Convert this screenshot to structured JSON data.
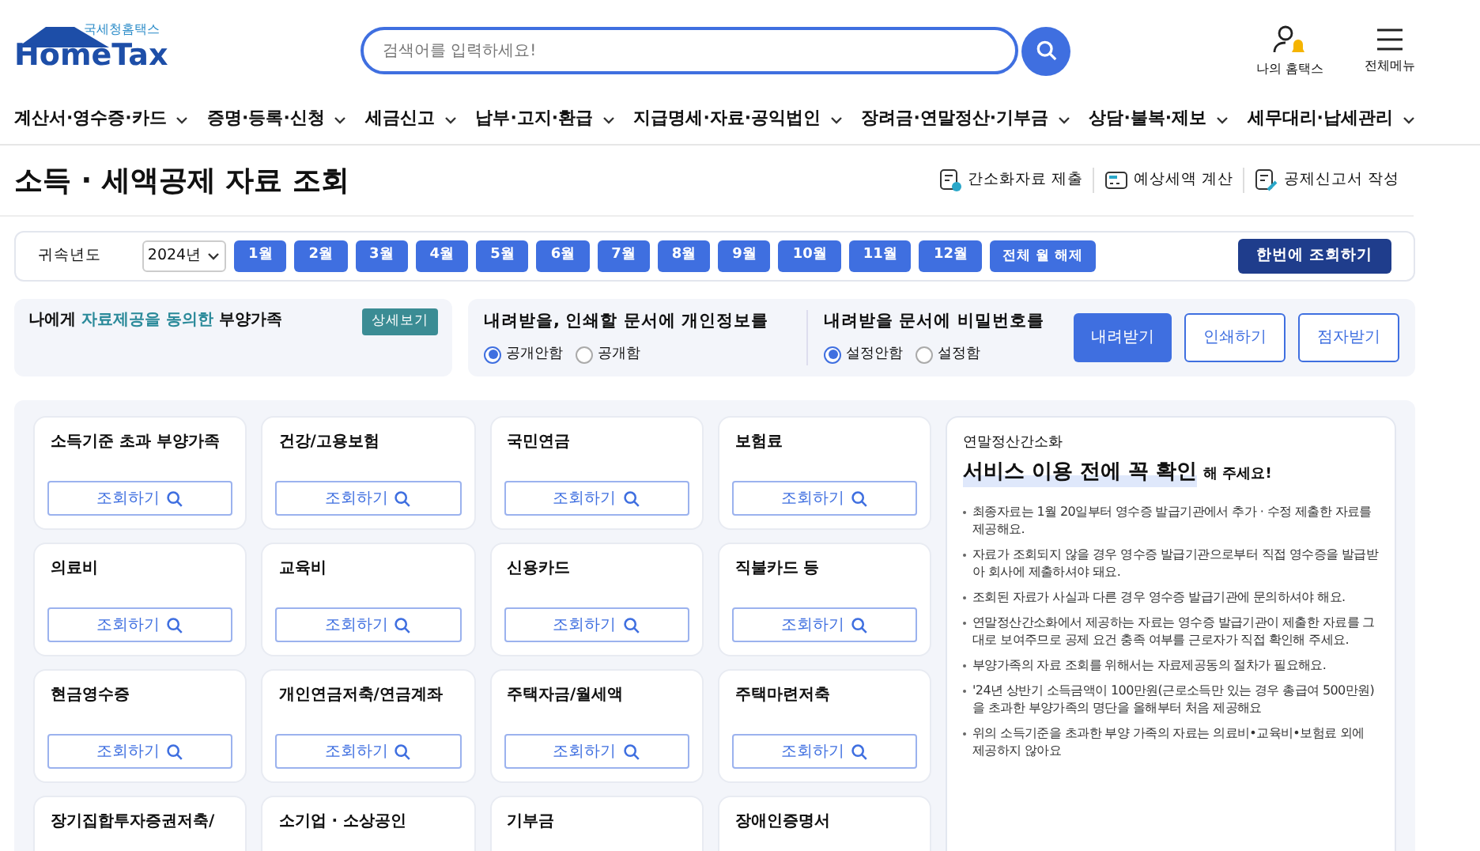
{
  "header": {
    "logo_small": "국세청홈택스",
    "logo_main": "HomeTax",
    "search_placeholder": "검색어를 입력하세요!",
    "actions": [
      {
        "kind": "user",
        "label": "나의 홈택스"
      },
      {
        "kind": "menu",
        "label": "전체메뉴"
      }
    ]
  },
  "nav": [
    "계산서·영수증·카드",
    "증명·등록·신청",
    "세금신고",
    "납부·고지·환급",
    "지급명세·자료·공익법인",
    "장려금·연말정산·기부금",
    "상담·불복·제보",
    "세무대리·납세관리"
  ],
  "page": {
    "title": "소득 · 세액공제 자료 조회",
    "links": [
      {
        "kind": "submit",
        "label": "간소화자료 제출"
      },
      {
        "kind": "calc",
        "label": "예상세액 계산"
      },
      {
        "kind": "write",
        "label": "공제신고서 작성"
      }
    ]
  },
  "filter": {
    "label": "귀속년도",
    "year": "2024년",
    "months": [
      {
        "label": "1월",
        "selected": true
      },
      {
        "label": "2월",
        "selected": true
      },
      {
        "label": "3월",
        "selected": true
      },
      {
        "label": "4월",
        "selected": true
      },
      {
        "label": "5월",
        "selected": true
      },
      {
        "label": "6월",
        "selected": true
      },
      {
        "label": "7월",
        "selected": true
      },
      {
        "label": "8월",
        "selected": true
      },
      {
        "label": "9월",
        "selected": true
      },
      {
        "label": "10월",
        "selected": true
      },
      {
        "label": "11월",
        "selected": true
      },
      {
        "label": "12월",
        "selected": true
      }
    ],
    "clear_button": "전체 월 해제",
    "query_all_button": "한번에 조회하기"
  },
  "consent": {
    "text": "나에게 **자료제공을 동의한** 부양가족",
    "button": "상세보기"
  },
  "options": [
    {
      "title": "내려받을, 인쇄할 문서에 개인정보를",
      "choices": [
        {
          "label": "공개안함",
          "selected": true
        },
        {
          "label": "공개함",
          "selected": false
        }
      ]
    },
    {
      "title": "내려받을 문서에 비밀번호를",
      "choices": [
        {
          "label": "설정안함",
          "selected": true
        },
        {
          "label": "설정함",
          "selected": false
        }
      ]
    }
  ],
  "actions": [
    {
      "label": "내려받기",
      "primary": true
    },
    {
      "label": "인쇄하기",
      "primary": false
    },
    {
      "label": "점자받기",
      "primary": false
    }
  ],
  "cards": [
    {
      "title": "소득기준 초과 부양가족",
      "button": "조회하기"
    },
    {
      "title": "건강/고용보험",
      "button": "조회하기"
    },
    {
      "title": "국민연금",
      "button": "조회하기"
    },
    {
      "title": "보험료",
      "button": "조회하기"
    },
    {
      "title": "의료비",
      "button": "조회하기"
    },
    {
      "title": "교육비",
      "button": "조회하기"
    },
    {
      "title": "신용카드",
      "button": "조회하기"
    },
    {
      "title": "직불카드 등",
      "button": "조회하기"
    },
    {
      "title": "현금영수증",
      "button": "조회하기"
    },
    {
      "title": "개인연금저축/연금계좌",
      "button": "조회하기"
    },
    {
      "title": "주택자금/월세액",
      "button": "조회하기"
    },
    {
      "title": "주택마련저축",
      "button": "조회하기"
    },
    {
      "title": "장기집합투자증권저축/"
    },
    {
      "title": "소기업 · 소상공인"
    },
    {
      "title": "기부금"
    },
    {
      "title": "장애인증명서"
    }
  ],
  "notice": {
    "eyebrow": "연말정산간소화",
    "headline": "서비스 이용 전에 꼭 확인",
    "headline_suffix": "해 주세요!",
    "items": [
      "최종자료는 1월 20일부터 영수증 발급기관에서 추가 · 수정 제출한 자료를 제공해요.",
      "자료가 조회되지 않을 경우 영수증 발급기관으로부터 직접 영수증을 발급받아 회사에 제출하셔야 돼요.",
      "조회된 자료가 사실과 다른 경우 영수증 발급기관에 문의하셔야 해요.",
      "연말정산간소화에서 제공하는 자료는 영수증 발급기관이 제출한 자료를 그대로 보여주므로 공제 요건 충족 여부를 근로자가 직접 확인해 주세요.",
      "부양가족의 자료 조회를 위해서는 자료제공동의 절차가 필요해요.",
      "'24년 상반기 소득금액이 100만원(근로소득만 있는 경우 총급여 500만원)을 초과한 부양가족의 명단을 올해부터 처음 제공해요",
      "위의 소득기준을 초과한 부양 가족의 자료는 의료비•교육비•보험료 외에 제공하지 않아요"
    ]
  }
}
